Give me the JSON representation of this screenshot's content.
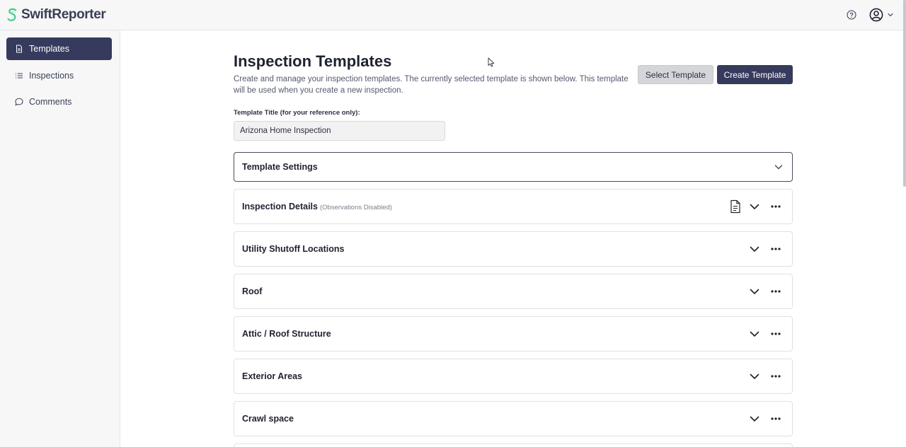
{
  "header": {
    "brand": "SwiftReporter",
    "brand_color": "#3ecf8e",
    "icons": [
      "help-circle-icon",
      "user-circle-icon",
      "chevron-down-icon"
    ]
  },
  "sidebar": {
    "items": [
      {
        "label": "Templates",
        "icon": "document-icon",
        "active": true
      },
      {
        "label": "Inspections",
        "icon": "list-icon",
        "active": false
      },
      {
        "label": "Comments",
        "icon": "chat-bubble-icon",
        "active": false
      }
    ],
    "active_color": "#363a5c"
  },
  "main": {
    "title": "Inspection Templates",
    "description": "Create and manage your inspection templates. The currently selected template is shown below. This template will be used when you create a new inspection.",
    "buttons": {
      "select": "Select Template",
      "create": "Create Template"
    },
    "template_title_label": "Template Title (for your reference only):",
    "template_title_value": "Arizona Home Inspection",
    "settings_panel": "Template Settings",
    "sections": [
      {
        "title": "Inspection Details",
        "note": "(Observations Disabled)"
      },
      {
        "title": "Utility Shutoff Locations",
        "note": ""
      },
      {
        "title": "Roof",
        "note": ""
      },
      {
        "title": "Attic / Roof Structure",
        "note": ""
      },
      {
        "title": "Exterior Areas",
        "note": ""
      },
      {
        "title": "Crawl space",
        "note": ""
      }
    ]
  }
}
